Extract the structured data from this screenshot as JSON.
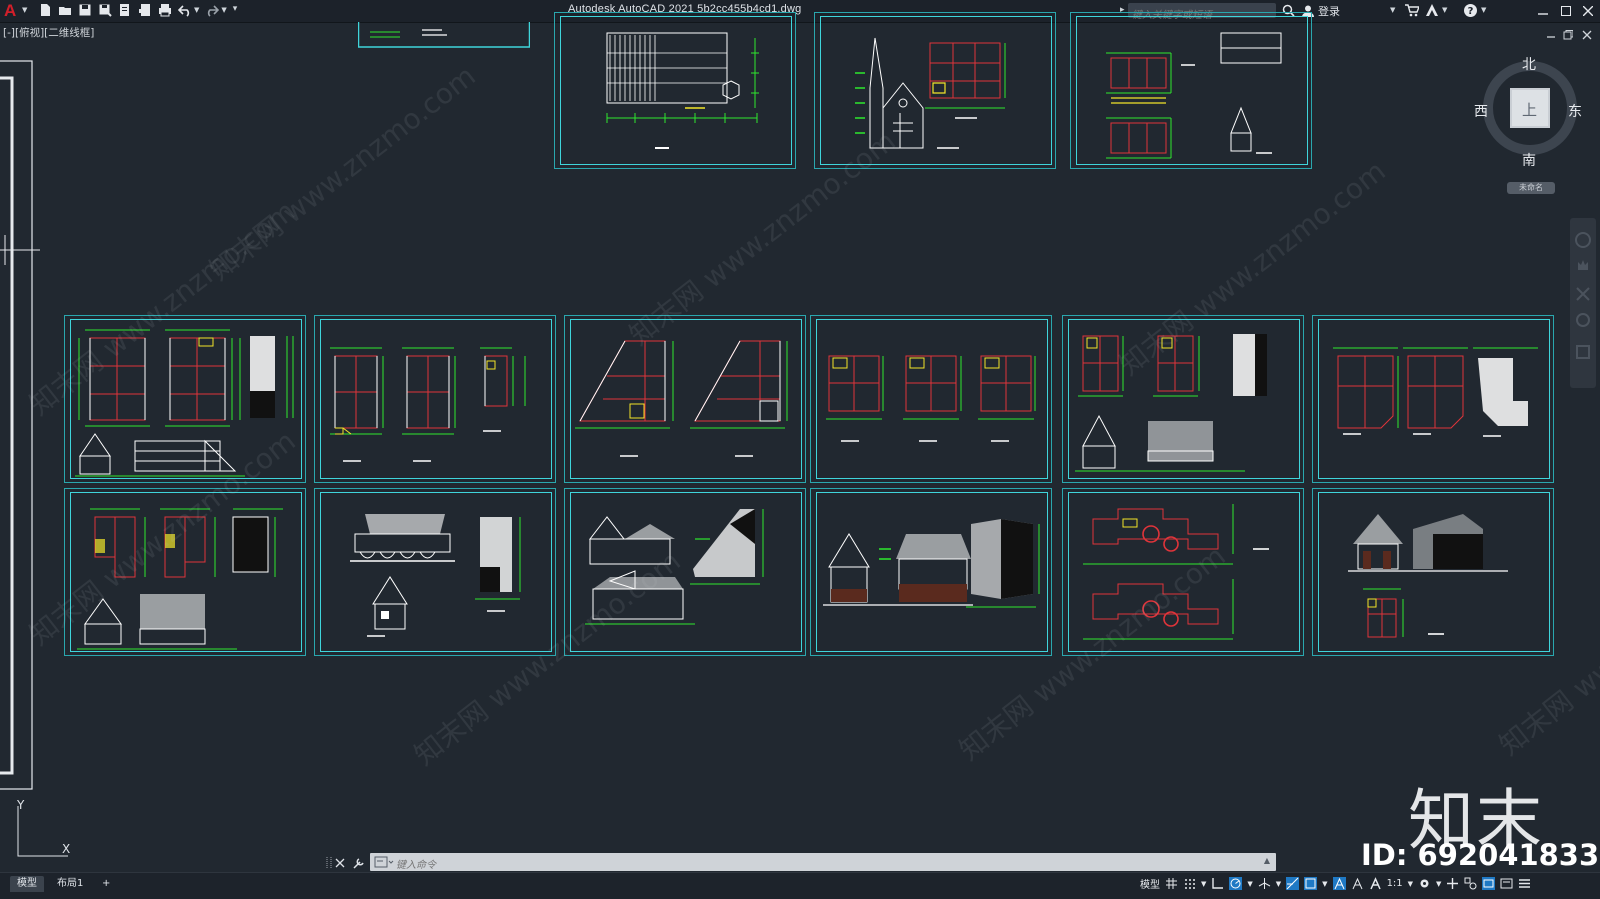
{
  "app": {
    "logo": "A",
    "title": "Autodesk AutoCAD 2021    5b2cc455b4cd1.dwg"
  },
  "search": {
    "placeholder": "键入关键字或短语"
  },
  "user": {
    "sign_in_label": "登录"
  },
  "viewport": {
    "label": "[-][俯视][二维线框]"
  },
  "viewcube": {
    "north": "北",
    "south": "南",
    "east": "东",
    "west": "西",
    "face": "上",
    "ucs_label": "未命名"
  },
  "ucs": {
    "y_label": "Y",
    "x_label": "X"
  },
  "command": {
    "placeholder": "键入命令"
  },
  "layout_tabs": [
    "模型",
    "布局1"
  ],
  "add_tab_label": "+",
  "status": {
    "model_label": "模型",
    "scale_label": "1:1"
  },
  "watermarks": [
    "知末网 www.znzmo.com",
    "知末网 www.znzmo.com",
    "知末网 www.znzmo.com",
    "知末网 www.znzmo.com",
    "知末网 www.znzmo.com",
    "知末网 www.znzmo.com",
    "知末网 www.znzmo.com",
    "知末网 www.znzmo.com"
  ],
  "branding": {
    "logo_text": "知末",
    "id_text": "ID: 692041833"
  },
  "colors": {
    "background": "#212830",
    "sheet_border": "#3fd5db",
    "dimension": "#2ee82e",
    "grid_axis": "#e0343a",
    "wall": "#ffffff",
    "highlight": "#f2e529"
  }
}
